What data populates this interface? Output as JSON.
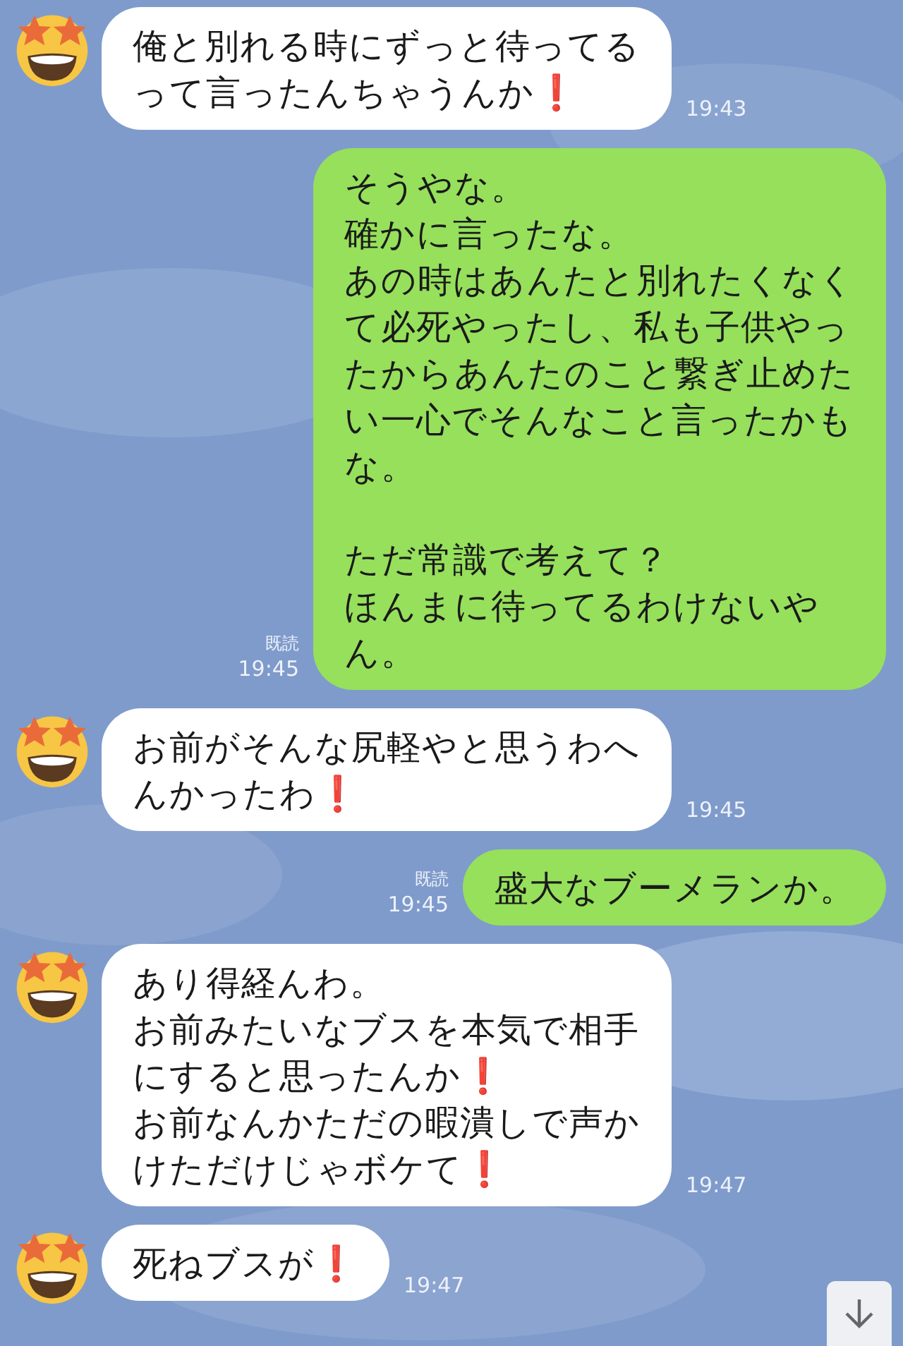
{
  "messages": [
    {
      "kind": "incoming",
      "paragraphs": [
        [
          "俺と別れる時にずっと待ってる",
          "って言ったんちゃうんか❗"
        ]
      ],
      "time": "19:43"
    },
    {
      "kind": "outgoing",
      "paragraphs": [
        [
          "そうやな。",
          "確かに言ったな。",
          "あの時はあんたと別れたくなく",
          "て必死やったし、私も子供やっ",
          "たからあんたのこと繋ぎ止めた",
          "い一心でそんなこと言ったかも",
          "な。"
        ],
        [
          "ただ常識で考えて？",
          "ほんまに待ってるわけないや",
          "ん。"
        ]
      ],
      "read_label": "既読",
      "time": "19:45"
    },
    {
      "kind": "incoming",
      "paragraphs": [
        [
          "お前がそんな尻軽やと思うわへ",
          "んかったわ❗"
        ]
      ],
      "time": "19:45"
    },
    {
      "kind": "outgoing",
      "paragraphs": [
        [
          "盛大なブーメランか。"
        ]
      ],
      "read_label": "既読",
      "time": "19:45"
    },
    {
      "kind": "incoming",
      "paragraphs": [
        [
          "あり得経んわ。",
          "お前みたいなブスを本気で相手",
          "にすると思ったんか❗",
          "お前なんかただの暇潰しで声か",
          "けただけじゃボケて❗"
        ]
      ],
      "time": "19:47"
    },
    {
      "kind": "incoming",
      "paragraphs": [
        [
          "死ねブスが❗"
        ]
      ],
      "time": "19:47"
    }
  ]
}
